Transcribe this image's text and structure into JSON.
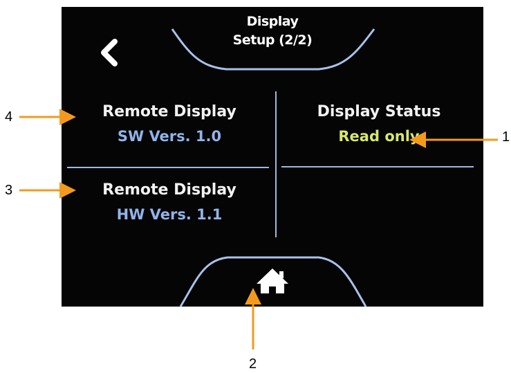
{
  "screen": {
    "title_line1": "Display",
    "title_line2": "Setup (2/2)",
    "back_icon": "chevron-left-icon",
    "home_icon": "home-icon"
  },
  "cells": {
    "sw_version": {
      "label": "Remote Display",
      "value": "SW Vers. 1.0"
    },
    "display_status": {
      "label": "Display Status",
      "value": "Read only"
    },
    "hw_version": {
      "label": "Remote Display",
      "value": "HW Vers. 1.1"
    }
  },
  "callouts": {
    "c1": "1",
    "c2": "2",
    "c3": "3",
    "c4": "4"
  },
  "colors": {
    "background": "#050505",
    "label_text": "#f2f2f2",
    "version_value": "#8fb4ea",
    "status_value": "#d8e86a",
    "divider": "#9fb8e0",
    "arrow": "#f39a1e"
  }
}
